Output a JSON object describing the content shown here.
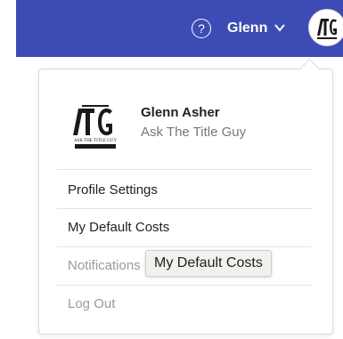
{
  "header": {
    "help_glyph": "?",
    "user_menu_label": "Glenn",
    "bar_color": "#3c4cb4"
  },
  "profile": {
    "name": "Glenn Asher",
    "company": "Ask The Title Guy",
    "logo_monogram": "ATG",
    "logo_text": "ASK THE TITLE GUY"
  },
  "menu": {
    "items": [
      {
        "label": "Profile Settings",
        "muted": false
      },
      {
        "label": "My Default Costs",
        "muted": false
      },
      {
        "label": "Notifications",
        "muted": true
      },
      {
        "label": "Log Out",
        "muted": true
      }
    ]
  },
  "tooltip": {
    "text": "My Default Costs"
  }
}
